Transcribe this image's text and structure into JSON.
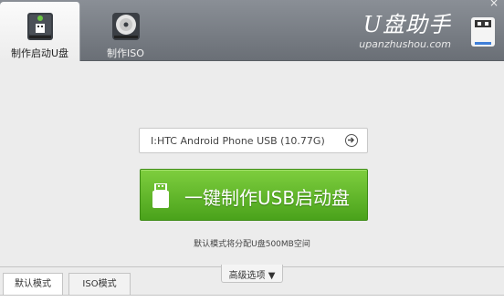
{
  "header": {
    "tabs": [
      {
        "label": "制作启动U盘",
        "active": true,
        "icon": "usb-drive-icon"
      },
      {
        "label": "制作ISO",
        "active": false,
        "icon": "disc-icon"
      }
    ],
    "brand_title": "U盘助手",
    "brand_url": "upanzhushou.com",
    "close_glyph": "×"
  },
  "main": {
    "drive_value": "I:HTC Android Phone USB (10.77G)",
    "make_button_label": "一键制作USB启动盘",
    "hint": "默认模式将分配U盘500MB空间"
  },
  "bottom": {
    "advanced_label": "高级选项 ▼",
    "tabs": [
      {
        "label": "默认模式"
      },
      {
        "label": "ISO模式"
      }
    ]
  },
  "colors": {
    "header": "#7a7f86",
    "button_green": "#5fb82a",
    "background": "#ececec"
  }
}
